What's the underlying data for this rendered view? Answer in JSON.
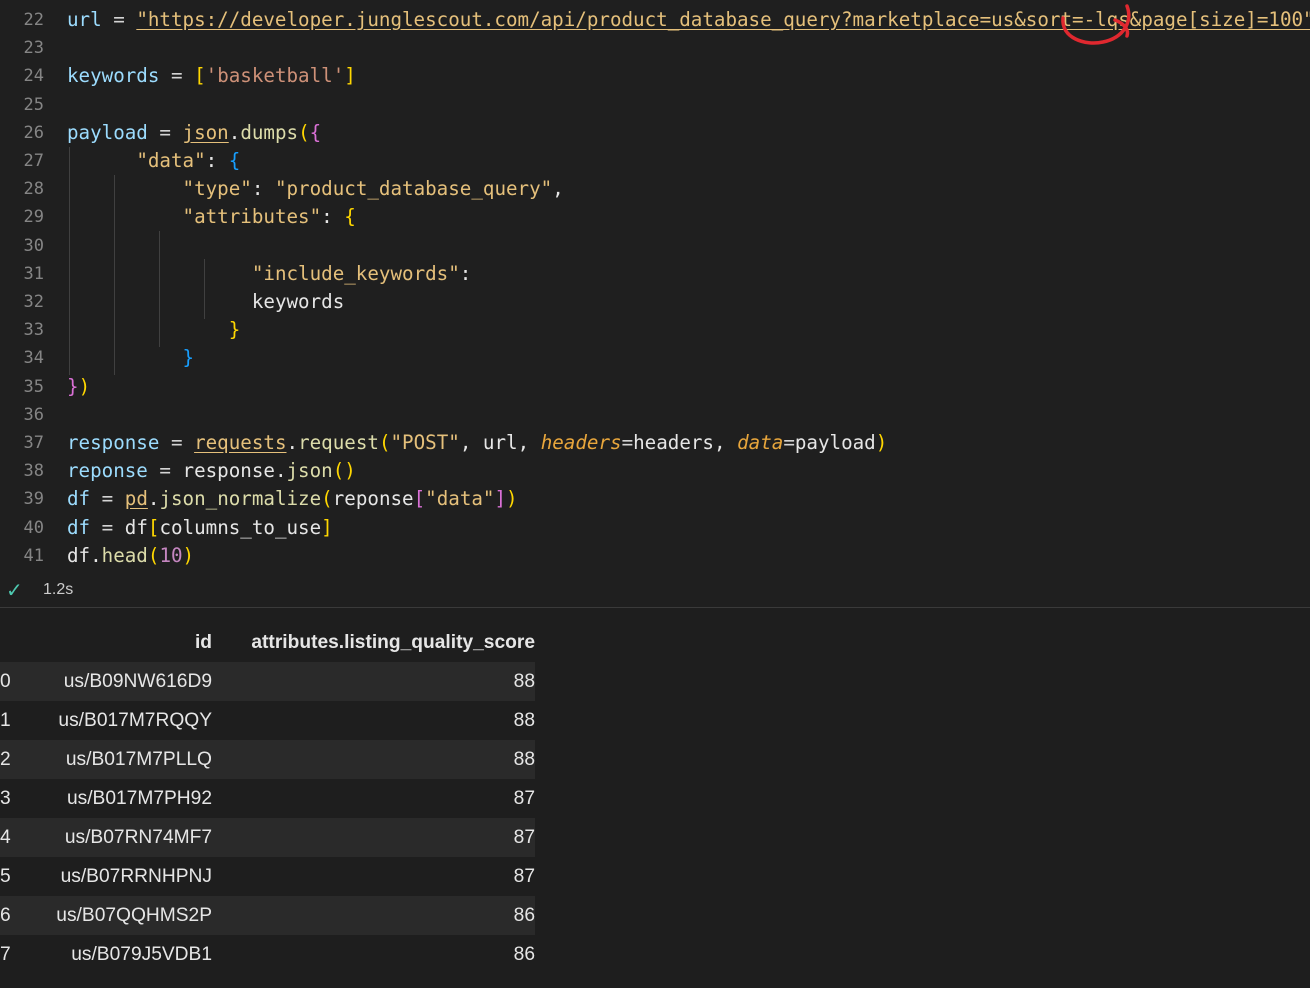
{
  "editor": {
    "lines": [
      {
        "n": "22",
        "tokens": [
          {
            "c": "k",
            "t": "url"
          },
          {
            "c": "op",
            "t": " = "
          },
          {
            "c": "surl",
            "t": "\"https://developer.junglescout.com/api/product_database_query?marketplace=us&sort=-lqs&page[size]=100\""
          }
        ]
      },
      {
        "n": "23",
        "tokens": []
      },
      {
        "n": "24",
        "tokens": [
          {
            "c": "k",
            "t": "keywords"
          },
          {
            "c": "op",
            "t": " = "
          },
          {
            "c": "b1",
            "t": "["
          },
          {
            "c": "s",
            "t": "'basketball'"
          },
          {
            "c": "b1",
            "t": "]"
          }
        ]
      },
      {
        "n": "25",
        "tokens": []
      },
      {
        "n": "26",
        "tokens": [
          {
            "c": "k",
            "t": "payload"
          },
          {
            "c": "op",
            "t": " = "
          },
          {
            "c": "ufn",
            "t": "json"
          },
          {
            "c": "plain",
            "t": "."
          },
          {
            "c": "fn",
            "t": "dumps"
          },
          {
            "c": "b1",
            "t": "("
          },
          {
            "c": "b2",
            "t": "{"
          }
        ]
      },
      {
        "n": "27",
        "tokens": [
          {
            "c": "plain",
            "t": "      "
          },
          {
            "c": "ss",
            "t": "\"data\""
          },
          {
            "c": "plain",
            "t": ": "
          },
          {
            "c": "b3",
            "t": "{"
          }
        ]
      },
      {
        "n": "28",
        "tokens": [
          {
            "c": "plain",
            "t": "          "
          },
          {
            "c": "ss",
            "t": "\"type\""
          },
          {
            "c": "plain",
            "t": ": "
          },
          {
            "c": "ss",
            "t": "\"product_database_query\""
          },
          {
            "c": "plain",
            "t": ","
          }
        ]
      },
      {
        "n": "29",
        "tokens": [
          {
            "c": "plain",
            "t": "          "
          },
          {
            "c": "ss",
            "t": "\"attributes\""
          },
          {
            "c": "plain",
            "t": ": "
          },
          {
            "c": "b1",
            "t": "{"
          }
        ]
      },
      {
        "n": "30",
        "tokens": []
      },
      {
        "n": "31",
        "tokens": [
          {
            "c": "plain",
            "t": "                "
          },
          {
            "c": "ss",
            "t": "\"include_keywords\""
          },
          {
            "c": "plain",
            "t": ":"
          }
        ]
      },
      {
        "n": "32",
        "tokens": [
          {
            "c": "plain",
            "t": "                "
          },
          {
            "c": "plain",
            "t": "keywords"
          }
        ]
      },
      {
        "n": "33",
        "tokens": [
          {
            "c": "plain",
            "t": "              "
          },
          {
            "c": "b1",
            "t": "}"
          }
        ]
      },
      {
        "n": "34",
        "tokens": [
          {
            "c": "plain",
            "t": "          "
          },
          {
            "c": "b3",
            "t": "}"
          }
        ]
      },
      {
        "n": "35",
        "tokens": [
          {
            "c": "b2",
            "t": "}"
          },
          {
            "c": "b1",
            "t": ")"
          }
        ]
      },
      {
        "n": "36",
        "tokens": []
      },
      {
        "n": "37",
        "tokens": [
          {
            "c": "k",
            "t": "response"
          },
          {
            "c": "op",
            "t": " = "
          },
          {
            "c": "ufn",
            "t": "requests"
          },
          {
            "c": "plain",
            "t": "."
          },
          {
            "c": "fn",
            "t": "request"
          },
          {
            "c": "b1",
            "t": "("
          },
          {
            "c": "ss",
            "t": "\"POST\""
          },
          {
            "c": "plain",
            "t": ", url, "
          },
          {
            "c": "kw",
            "t": "headers"
          },
          {
            "c": "op",
            "t": "="
          },
          {
            "c": "plain",
            "t": "headers, "
          },
          {
            "c": "kw",
            "t": "data"
          },
          {
            "c": "op",
            "t": "="
          },
          {
            "c": "plain",
            "t": "payload"
          },
          {
            "c": "b1",
            "t": ")"
          }
        ]
      },
      {
        "n": "38",
        "tokens": [
          {
            "c": "k",
            "t": "reponse"
          },
          {
            "c": "op",
            "t": " = "
          },
          {
            "c": "plain",
            "t": "response."
          },
          {
            "c": "fn",
            "t": "json"
          },
          {
            "c": "b1",
            "t": "()"
          }
        ]
      },
      {
        "n": "39",
        "tokens": [
          {
            "c": "k",
            "t": "df"
          },
          {
            "c": "op",
            "t": " = "
          },
          {
            "c": "ufn",
            "t": "pd"
          },
          {
            "c": "plain",
            "t": "."
          },
          {
            "c": "fn",
            "t": "json_normalize"
          },
          {
            "c": "b1",
            "t": "("
          },
          {
            "c": "plain",
            "t": "reponse"
          },
          {
            "c": "b2",
            "t": "["
          },
          {
            "c": "ss",
            "t": "\"data\""
          },
          {
            "c": "b2",
            "t": "]"
          },
          {
            "c": "b1",
            "t": ")"
          }
        ]
      },
      {
        "n": "40",
        "tokens": [
          {
            "c": "k",
            "t": "df"
          },
          {
            "c": "op",
            "t": " = "
          },
          {
            "c": "plain",
            "t": "df"
          },
          {
            "c": "b1",
            "t": "["
          },
          {
            "c": "plain",
            "t": "columns_to_use"
          },
          {
            "c": "b1",
            "t": "]"
          }
        ]
      },
      {
        "n": "41",
        "tokens": [
          {
            "c": "plain",
            "t": "df."
          },
          {
            "c": "fn",
            "t": "head"
          },
          {
            "c": "b1",
            "t": "("
          },
          {
            "c": "num",
            "t": "10"
          },
          {
            "c": "b1",
            "t": ")"
          }
        ]
      }
    ]
  },
  "status": {
    "duration": "1.2s"
  },
  "output": {
    "columns": [
      "id",
      "attributes.listing_quality_score"
    ],
    "rows": [
      {
        "idx": "0",
        "id": "us/B09NW616D9",
        "score": "88"
      },
      {
        "idx": "1",
        "id": "us/B017M7RQQY",
        "score": "88"
      },
      {
        "idx": "2",
        "id": "us/B017M7PLLQ",
        "score": "88"
      },
      {
        "idx": "3",
        "id": "us/B017M7PH92",
        "score": "87"
      },
      {
        "idx": "4",
        "id": "us/B07RN74MF7",
        "score": "87"
      },
      {
        "idx": "5",
        "id": "us/B07RRNHPNJ",
        "score": "87"
      },
      {
        "idx": "6",
        "id": "us/B07QQHMS2P",
        "score": "86"
      },
      {
        "idx": "7",
        "id": "us/B079J5VDB1",
        "score": "86"
      }
    ]
  },
  "annotation_color": "#e0282f"
}
